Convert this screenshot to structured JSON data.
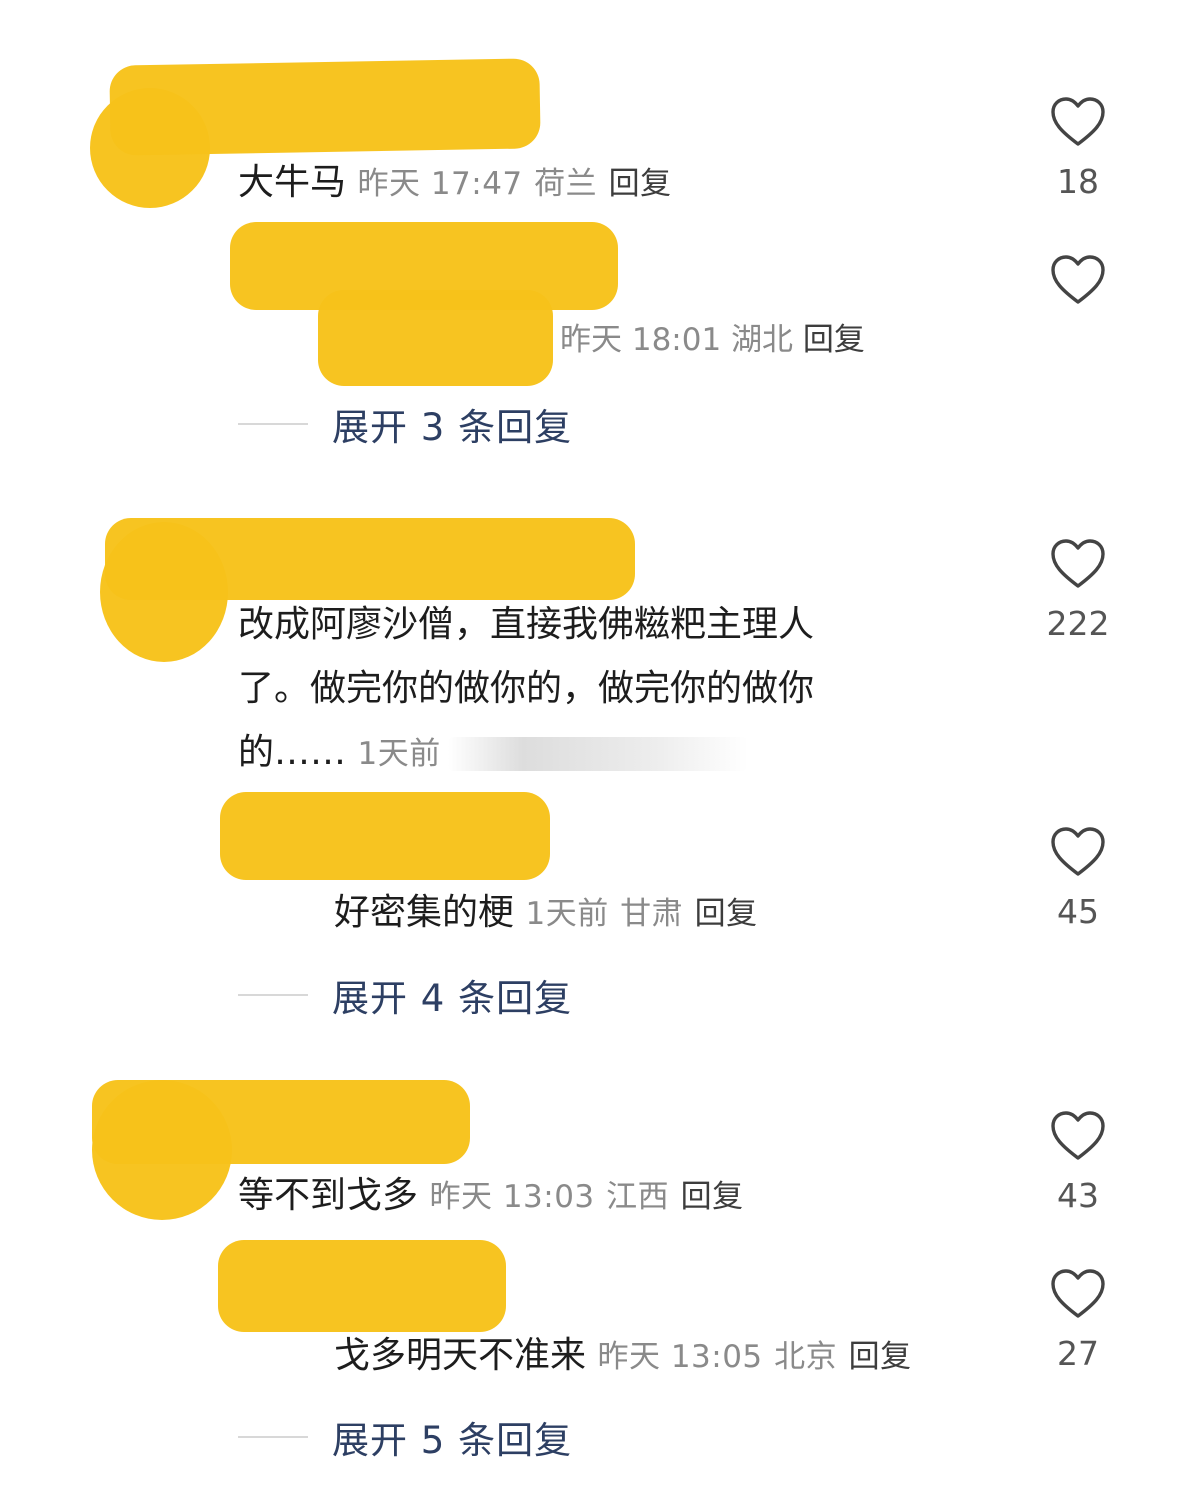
{
  "comments": [
    {
      "text": "大牛马",
      "time": "昨天 17:47",
      "location": "荷兰",
      "reply_label": "回复",
      "likes": "18",
      "reply": {
        "text": "",
        "time": "昨天 18:01",
        "location": "湖北",
        "reply_label": "回复",
        "likes": ""
      },
      "expand_label": "展开 3 条回复"
    },
    {
      "text_line1": "改成阿廖沙僧，直接我佛糍粑主理人",
      "text_line2": "了。做完你的做你的，做完你的做你",
      "text_line3": "的……",
      "time": "1天前",
      "likes": "222",
      "reply": {
        "text": "好密集的梗",
        "time": "1天前",
        "location": "甘肃",
        "reply_label": "回复",
        "likes": "45"
      },
      "expand_label": "展开 4 条回复"
    },
    {
      "text": "等不到戈多",
      "time": "昨天 13:03",
      "location": "江西",
      "reply_label": "回复",
      "likes": "43",
      "reply": {
        "text": "戈多明天不准来",
        "time": "昨天 13:05",
        "location": "北京",
        "reply_label": "回复",
        "likes": "27"
      },
      "expand_label": "展开 5 条回复"
    }
  ],
  "colors": {
    "redaction": "#f7c21a",
    "expand_text": "#2d3f63",
    "meta_text": "#8a8a8a"
  },
  "icons": {
    "like": "heart-outline-icon"
  }
}
